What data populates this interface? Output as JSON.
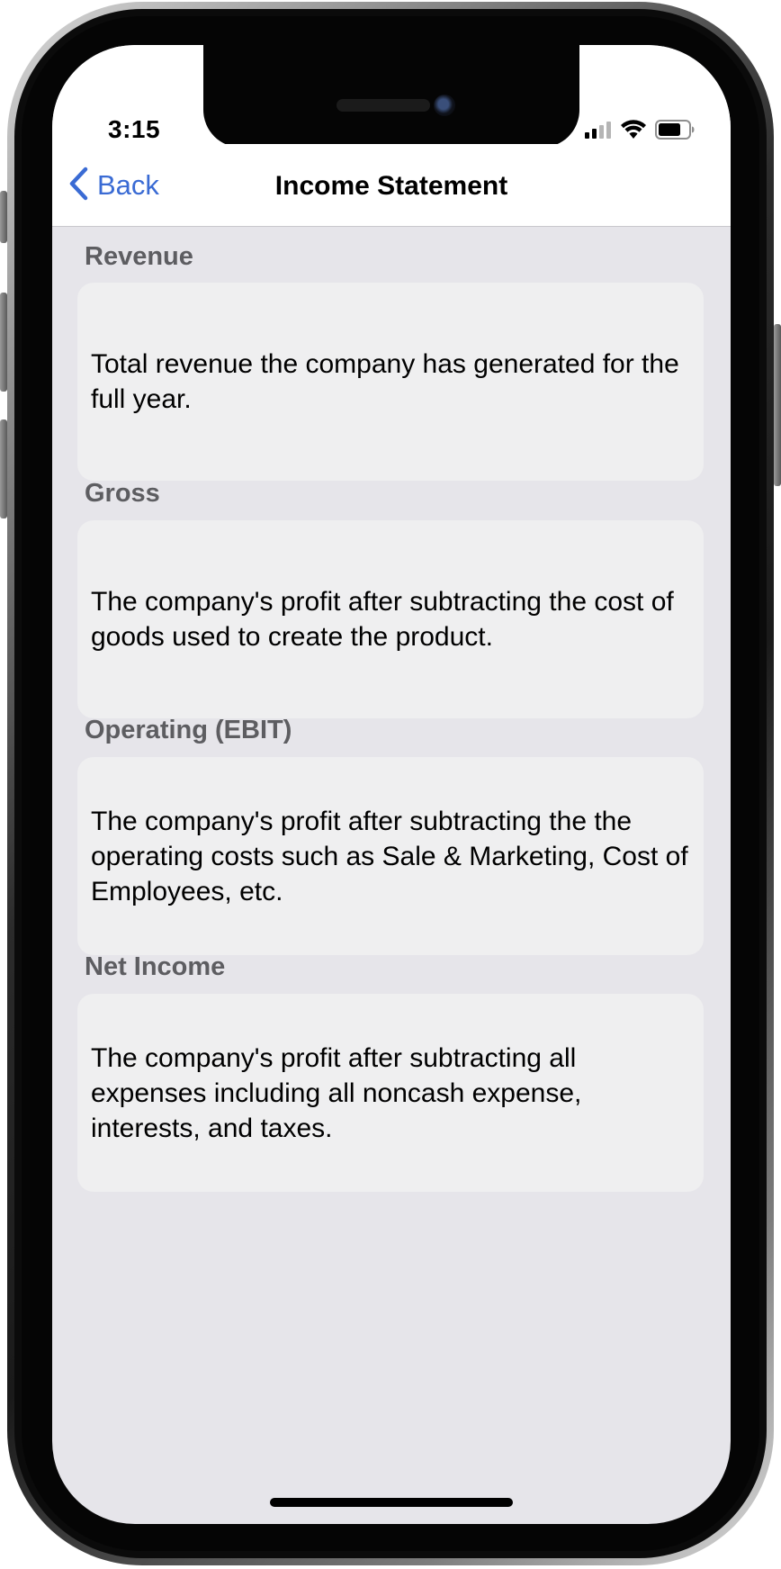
{
  "status_bar": {
    "time": "3:15",
    "icons": [
      "cellular-signal-icon",
      "wifi-icon",
      "battery-icon"
    ]
  },
  "nav": {
    "back_label": "Back",
    "title": "Income Statement"
  },
  "sections": [
    {
      "header": "Revenue",
      "body": "Total revenue the company has generated for the full year."
    },
    {
      "header": "Gross",
      "body": "The company's profit after subtracting the cost of goods used to create the product."
    },
    {
      "header": "Operating (EBIT)",
      "body": "The company's profit after subtracting the the operating costs such as Sale & Marketing, Cost of Employees, etc."
    },
    {
      "header": "Net Income",
      "body": "The company's profit after subtracting all expenses including all noncash expense, interests, and taxes."
    }
  ],
  "colors": {
    "accent": "#3a6bd4",
    "background": "#e6e5ea",
    "card": "#efeff0",
    "section_header": "#5d5d61"
  }
}
